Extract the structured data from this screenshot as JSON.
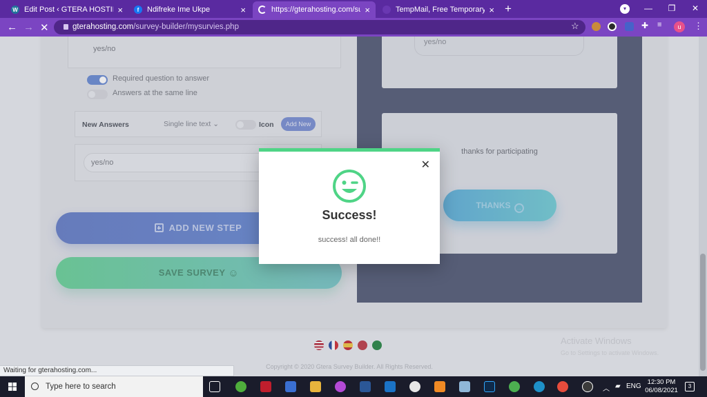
{
  "browser": {
    "tabs": [
      {
        "title": "Edit Post ‹ GTERA HOSTING — W",
        "favicon": "wordpress-icon",
        "color": "#21759b"
      },
      {
        "title": "Ndifreke Ime Ukpe",
        "favicon": "facebook-icon",
        "color": "#1877f2"
      },
      {
        "title": "https://gterahosting.com/survey",
        "favicon": "loading-icon",
        "color": "#ffffff"
      },
      {
        "title": "TempMail, Free Temporary Mail A",
        "favicon": "tempmail-icon",
        "color": "#7b45c2"
      }
    ],
    "url_host": "gterahosting.com",
    "url_path": "/survey-builder/mysurvies.php",
    "profile_initial": "u",
    "status_text": "Waiting for gterahosting.com..."
  },
  "builder": {
    "answer_preview": "yes/no",
    "required_label": "Required question to answer",
    "same_line_label": "Answers at the same line",
    "new_answers_label": "New Answers",
    "answer_type": "Single line text",
    "icon_label": "Icon",
    "add_new_label": "Add New",
    "answer_input": "yes/no",
    "add_step_label": "ADD NEW STEP",
    "save_survey_label": "SAVE SURVEY",
    "required_on": true,
    "same_line_on": false
  },
  "preview": {
    "input_value": "yes/no",
    "thanks_message": "thanks for participating",
    "thanks_button": "THANKS"
  },
  "modal": {
    "title": "Success!",
    "message": "success! all done!!",
    "icon": "winking-smile-icon",
    "accent": "#4fd486"
  },
  "footer": {
    "copyright": "Copyright © 2020 Gtera Survey Builder. All Rights Reserved.",
    "activate_title": "Activate Windows",
    "activate_sub": "Go to Settings to activate Windows."
  },
  "taskbar": {
    "search_placeholder": "Type here to search",
    "language": "ENG",
    "time": "12:30 PM",
    "date": "06/08/2021",
    "notification_count": "3"
  }
}
